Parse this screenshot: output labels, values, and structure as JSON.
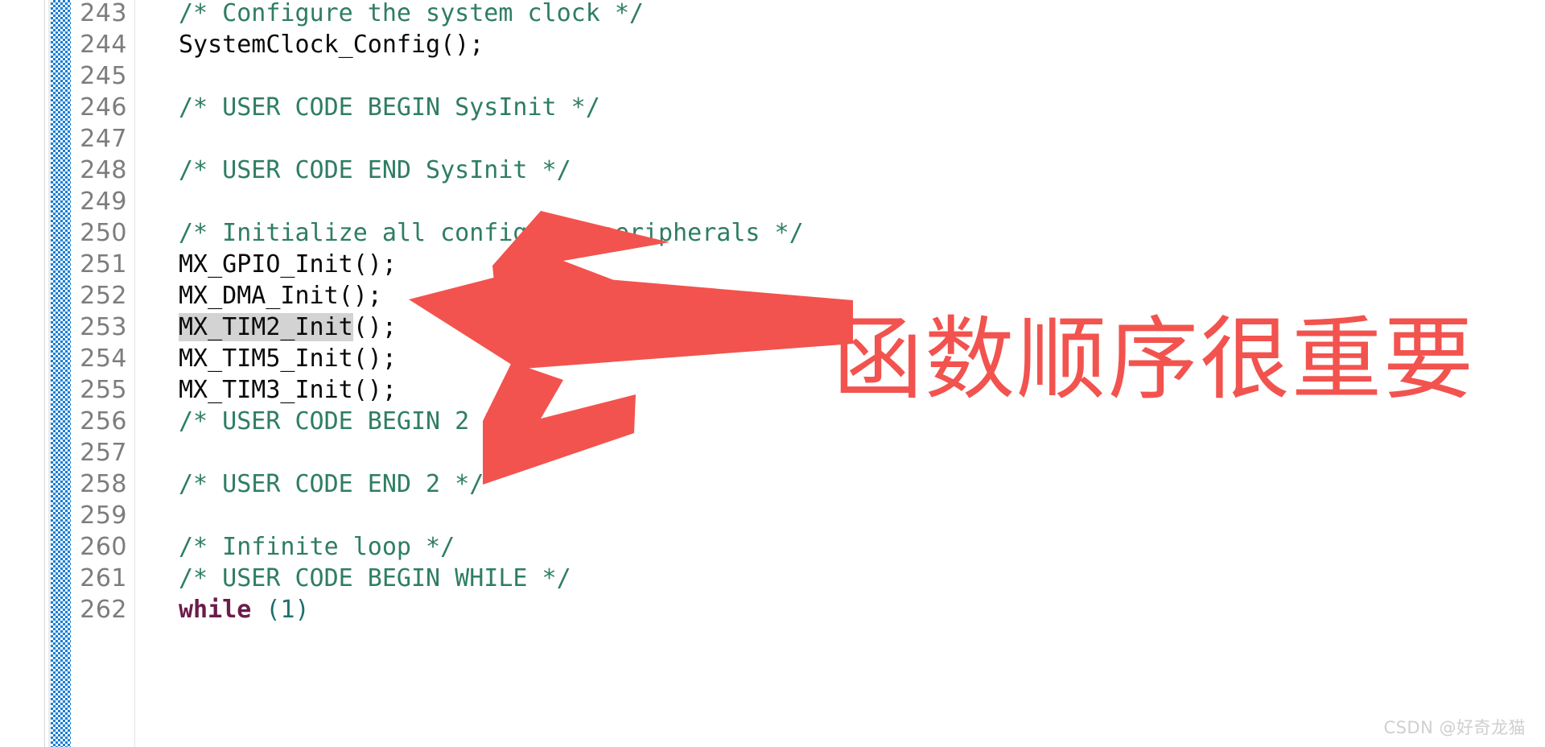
{
  "editor": {
    "language": "c",
    "gutter": {
      "change_bar_color": "#1a7fd4",
      "line_number_color": "#7d7d7d"
    },
    "colors": {
      "comment": "#2e7d64",
      "code": "#0a0a0a",
      "keyword": "#6b1d4a",
      "punctuation": "#1f6f6f",
      "highlight": "#d3d3d3",
      "background": "#ffffff"
    },
    "first_line_number": 243,
    "lines": [
      {
        "no": "243",
        "segments": [
          {
            "t": "/* Configure the system clock */",
            "c": "comment"
          }
        ]
      },
      {
        "no": "244",
        "segments": [
          {
            "t": "SystemClock_Config();",
            "c": "plain"
          }
        ]
      },
      {
        "no": "245",
        "segments": [
          {
            "t": "",
            "c": "plain"
          }
        ]
      },
      {
        "no": "246",
        "segments": [
          {
            "t": "/* USER CODE BEGIN SysInit */",
            "c": "comment"
          }
        ]
      },
      {
        "no": "247",
        "segments": [
          {
            "t": "",
            "c": "plain"
          }
        ]
      },
      {
        "no": "248",
        "segments": [
          {
            "t": "/* USER CODE END SysInit */",
            "c": "comment"
          }
        ]
      },
      {
        "no": "249",
        "segments": [
          {
            "t": "",
            "c": "plain"
          }
        ]
      },
      {
        "no": "250",
        "segments": [
          {
            "t": "/* Initialize all configured peripherals */",
            "c": "comment"
          }
        ]
      },
      {
        "no": "251",
        "segments": [
          {
            "t": "MX_GPIO_Init();",
            "c": "plain"
          }
        ]
      },
      {
        "no": "252",
        "segments": [
          {
            "t": "MX_DMA_Init();",
            "c": "plain"
          }
        ]
      },
      {
        "no": "253",
        "segments": [
          {
            "t": "MX_TIM2_Init",
            "c": "plain",
            "hl": true
          },
          {
            "t": "();",
            "c": "plain"
          }
        ]
      },
      {
        "no": "254",
        "segments": [
          {
            "t": "MX_TIM5_Init();",
            "c": "plain"
          }
        ]
      },
      {
        "no": "255",
        "segments": [
          {
            "t": "MX_TIM3_Init();",
            "c": "plain"
          }
        ]
      },
      {
        "no": "256",
        "segments": [
          {
            "t": "/* USER CODE BEGIN 2 */",
            "c": "comment"
          }
        ]
      },
      {
        "no": "257",
        "segments": [
          {
            "t": "",
            "c": "plain"
          }
        ]
      },
      {
        "no": "258",
        "segments": [
          {
            "t": "/* USER CODE END 2 */",
            "c": "comment"
          }
        ]
      },
      {
        "no": "259",
        "segments": [
          {
            "t": "",
            "c": "plain"
          }
        ]
      },
      {
        "no": "260",
        "segments": [
          {
            "t": "/* Infinite loop */",
            "c": "comment"
          }
        ]
      },
      {
        "no": "261",
        "segments": [
          {
            "t": "/* USER CODE BEGIN WHILE */",
            "c": "comment"
          }
        ]
      },
      {
        "no": "262",
        "segments": [
          {
            "t": "while",
            "c": "keyword"
          },
          {
            "t": " ",
            "c": "plain"
          },
          {
            "t": "(1)",
            "c": "punc"
          }
        ]
      }
    ]
  },
  "annotation": {
    "text": "函数顺序很重要",
    "color": "#f2534e",
    "arrow_color": "#f2534e",
    "arrow_count": 3,
    "arrow_targets": [
      "line-251",
      "line-253",
      "line-254"
    ]
  },
  "watermark": {
    "text": "CSDN @好奇龙猫"
  }
}
